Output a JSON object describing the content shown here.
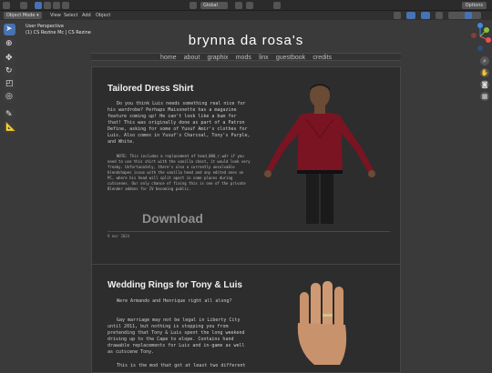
{
  "blender": {
    "options_label": "Options",
    "mode_label": "Object Mode",
    "menus": [
      "View",
      "Select",
      "Add",
      "Object"
    ],
    "orientation_label": "Global",
    "viewport_title": "User Perspective",
    "viewport_collection": "(1) CS Rezine Mc | CS Rezine Mc",
    "tools": [
      "select-box",
      "cursor",
      "move",
      "rotate",
      "scale",
      "transform",
      "annotate",
      "measure"
    ],
    "nav_icons": [
      "zoom",
      "hand",
      "camera",
      "grid"
    ],
    "axis_colors": {
      "x": "#e84f5a",
      "y": "#88c23b",
      "z": "#3f86e6"
    }
  },
  "site": {
    "title": "brynna da rosa's",
    "nav": [
      "home",
      "about",
      "graphix",
      "mods",
      "linx",
      "guestbook",
      "credits"
    ],
    "posts": [
      {
        "title": "Tailored Dress Shirt",
        "body": "Do you think Luis needs something real nice for his wardrobe? Perhaps Maisonette has a magazine feature coming up! He can't look like a bum for that! This was originally done as part of a Patron Define, asking for some of Yusuf Amir's clothes for Luis. Also comes in Yusuf's Charcoal, Tony's Purple, and White.",
        "note": "NOTE: This includes a replacement of head_000_r.wdr if you need to use this shirt with the vanilla chest, it would look very freaky. Unfortunately, there's also a currently unsolvable blendshapes issue with the vanilla head and any edited ones on PC, where his head will split apart in some places during cutscenes. Our only chance of fixing this is one of the private Blender addons for IV becoming public.",
        "download_label": "Download",
        "date": "9 mar 2024"
      },
      {
        "title": "Wedding Rings for Tony & Luis",
        "body_1": "Were Armando and Henrique right all along?",
        "body_2": "Gay marriage may not be legal in Liberty City until 2011, but nothing is stopping you from pretending that Tony & Luis spent the long weekend driving up to the Cape to elope. Contains hand drawable replacements for Luis and in-game as well as cutscene Tony.",
        "body_3": "This is the mod that got at least two different"
      }
    ]
  }
}
